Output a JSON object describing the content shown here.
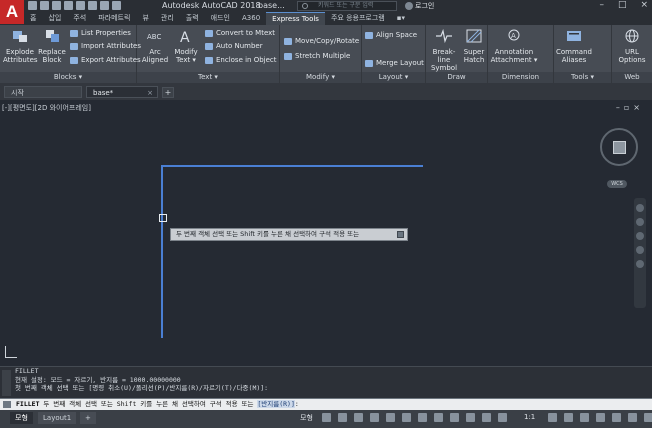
{
  "app": {
    "logo_letter": "A",
    "title": "Autodesk AutoCAD 2018",
    "doc_title": "base...",
    "search_placeholder": "키워드 또는 구문 입력",
    "user": "로그인"
  },
  "menu_tabs": [
    "홈",
    "삽입",
    "주석",
    "파라메트릭",
    "뷰",
    "관리",
    "출력",
    "애드인",
    "A360",
    "Express Tools",
    "주요 응용프로그램"
  ],
  "active_tab": "Express Tools",
  "ribbon": {
    "panels": [
      {
        "id": "blocks",
        "title": "Blocks",
        "big": [
          "Explode\nAttributes",
          "Replace\nBlock"
        ],
        "small": [
          "List Properties",
          "Import Attributes",
          "Export Attributes"
        ]
      },
      {
        "id": "text",
        "title": "Text",
        "big": [
          "Arc\nAligned",
          "Modify\nText"
        ],
        "small": [
          "Convert to Mtext",
          "Auto Number",
          "Enclose in Object"
        ]
      },
      {
        "id": "modify",
        "title": "Modify",
        "small": [
          "Move/Copy/Rotate",
          "Stretch Multiple"
        ]
      },
      {
        "id": "layout",
        "title": "Layout",
        "small": [
          "Align Space",
          "Merge Layout"
        ]
      },
      {
        "id": "draw",
        "title": "Draw",
        "big": [
          "Break-line\nSymbol",
          "Super\nHatch"
        ]
      },
      {
        "id": "dimension",
        "title": "Dimension",
        "big": [
          "Annotation\nAttachment"
        ]
      },
      {
        "id": "tools",
        "title": "Tools",
        "big": [
          "Command\nAliases"
        ]
      },
      {
        "id": "web",
        "title": "Web",
        "big": [
          "URL\nOptions"
        ]
      }
    ]
  },
  "file_tabs": {
    "start": "시작",
    "current": "base*"
  },
  "viewport": {
    "label": "[-][평면도][2D 와이어프레임]",
    "tooltip": "두 번째 객체 선택 또는 Shift 키를 누른 채 선택하여 구석 적용 또는",
    "wcs": "WCS"
  },
  "command_history": [
    "FILLET",
    "현재 설정: 모드 = 자르기, 반지름 = 1000.00000000",
    "첫 번째 객체 선택 또는 [명령 취소(U)/폴리선(P)/반지름(R)/자르기(T)/다중(M)]:"
  ],
  "command_line": {
    "command": "FILLET",
    "prompt": "두 번째 객체 선택 또는 Shift 키를 누른 채 선택하여 구석 적용 또는",
    "option": "[반지름(R)]",
    "suffix": ":"
  },
  "status_bar": {
    "tabs": [
      "모형",
      "Layout1"
    ],
    "model_label": "모형",
    "scale": "1:1"
  },
  "colors": {
    "accent": "#4a7fd4",
    "background": "#252a33",
    "logo": "#c62828"
  }
}
